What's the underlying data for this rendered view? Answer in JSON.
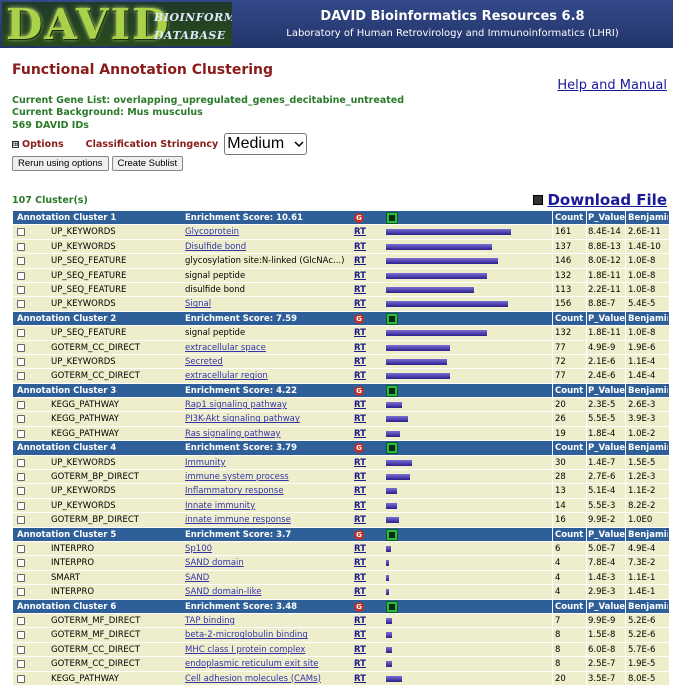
{
  "header": {
    "logo_text": "DAVID",
    "logo_sub1": "BIOINFORMATICS",
    "logo_sub2": "DATABASE",
    "title": "DAVID Bioinformatics Resources 6.8",
    "subtitle": "Laboratory of Human Retrovirology and Immunoinformatics (LHRI)"
  },
  "page_title": "Functional Annotation Clustering",
  "help_link": "Help and Manual",
  "gene_info": {
    "current_list": "Current Gene List: overlapping_upregulated_genes_decitabine_untreated",
    "background": "Current Background: Mus musculus",
    "ids": "569 DAVID IDs"
  },
  "options": {
    "plus": "⊞",
    "options_label": "Options",
    "stringency_label": "Classification Stringency",
    "stringency_value": "Medium",
    "rerun_button": "Rerun using options",
    "sublist_button": "Create Sublist"
  },
  "cluster_count": "107 Cluster(s)",
  "download_label": "Download File",
  "table_headers": {
    "count": "Count",
    "p_value": "P_Value",
    "benjamini": "Benjamini"
  },
  "clusters": [
    {
      "name": "Annotation Cluster 1",
      "score": "Enrichment Score: 10.61",
      "rows": [
        {
          "cat": "UP_KEYWORDS",
          "term": "Glycoprotein",
          "link": true,
          "bar": 0.78,
          "count": "161",
          "p": "8.4E-14",
          "b": "2.6E-11"
        },
        {
          "cat": "UP_KEYWORDS",
          "term": "Disulfide bond",
          "link": true,
          "bar": 0.66,
          "count": "137",
          "p": "8.8E-13",
          "b": "1.4E-10"
        },
        {
          "cat": "UP_SEQ_FEATURE",
          "term": "glycosylation site:N-linked (GlcNAc...)",
          "link": false,
          "bar": 0.7,
          "count": "146",
          "p": "8.0E-12",
          "b": "1.0E-8"
        },
        {
          "cat": "UP_SEQ_FEATURE",
          "term": "signal peptide",
          "link": false,
          "bar": 0.63,
          "count": "132",
          "p": "1.8E-11",
          "b": "1.0E-8"
        },
        {
          "cat": "UP_SEQ_FEATURE",
          "term": "disulfide bond",
          "link": false,
          "bar": 0.55,
          "count": "113",
          "p": "2.2E-11",
          "b": "1.0E-8"
        },
        {
          "cat": "UP_KEYWORDS",
          "term": "Signal",
          "link": true,
          "bar": 0.76,
          "count": "156",
          "p": "8.8E-7",
          "b": "5.4E-5"
        }
      ]
    },
    {
      "name": "Annotation Cluster 2",
      "score": "Enrichment Score: 7.59",
      "rows": [
        {
          "cat": "UP_SEQ_FEATURE",
          "term": "signal peptide",
          "link": false,
          "bar": 0.63,
          "count": "132",
          "p": "1.8E-11",
          "b": "1.0E-8"
        },
        {
          "cat": "GOTERM_CC_DIRECT",
          "term": "extracellular space",
          "link": true,
          "bar": 0.4,
          "count": "77",
          "p": "4.9E-9",
          "b": "1.9E-6"
        },
        {
          "cat": "UP_KEYWORDS",
          "term": "Secreted",
          "link": true,
          "bar": 0.38,
          "count": "72",
          "p": "2.1E-6",
          "b": "1.1E-4"
        },
        {
          "cat": "GOTERM_CC_DIRECT",
          "term": "extracellular region",
          "link": true,
          "bar": 0.4,
          "count": "77",
          "p": "2.4E-6",
          "b": "1.4E-4"
        }
      ]
    },
    {
      "name": "Annotation Cluster 3",
      "score": "Enrichment Score: 4.22",
      "rows": [
        {
          "cat": "KEGG_PATHWAY",
          "term": "Rap1 signaling pathway",
          "link": true,
          "bar": 0.1,
          "count": "20",
          "p": "2.3E-5",
          "b": "2.6E-3"
        },
        {
          "cat": "KEGG_PATHWAY",
          "term": "PI3K-Akt signaling pathway",
          "link": true,
          "bar": 0.14,
          "count": "26",
          "p": "5.5E-5",
          "b": "3.9E-3"
        },
        {
          "cat": "KEGG_PATHWAY",
          "term": "Ras signaling pathway",
          "link": true,
          "bar": 0.09,
          "count": "19",
          "p": "1.8E-4",
          "b": "1.0E-2"
        }
      ]
    },
    {
      "name": "Annotation Cluster 4",
      "score": "Enrichment Score: 3.79",
      "rows": [
        {
          "cat": "UP_KEYWORDS",
          "term": "Immunity",
          "link": true,
          "bar": 0.16,
          "count": "30",
          "p": "1.4E-7",
          "b": "1.5E-5"
        },
        {
          "cat": "GOTERM_BP_DIRECT",
          "term": "immune system process",
          "link": true,
          "bar": 0.15,
          "count": "28",
          "p": "2.7E-6",
          "b": "1.2E-3"
        },
        {
          "cat": "UP_KEYWORDS",
          "term": "Inflammatory response",
          "link": true,
          "bar": 0.07,
          "count": "13",
          "p": "5.1E-4",
          "b": "1.1E-2"
        },
        {
          "cat": "UP_KEYWORDS",
          "term": "Innate immunity",
          "link": true,
          "bar": 0.07,
          "count": "14",
          "p": "5.5E-3",
          "b": "8.2E-2"
        },
        {
          "cat": "GOTERM_BP_DIRECT",
          "term": "innate immune response",
          "link": true,
          "bar": 0.08,
          "count": "16",
          "p": "9.9E-2",
          "b": "1.0E0"
        }
      ]
    },
    {
      "name": "Annotation Cluster 5",
      "score": "Enrichment Score: 3.7",
      "rows": [
        {
          "cat": "INTERPRO",
          "term": "Sp100",
          "link": true,
          "bar": 0.03,
          "count": "6",
          "p": "5.0E-7",
          "b": "4.9E-4"
        },
        {
          "cat": "INTERPRO",
          "term": "SAND domain",
          "link": true,
          "bar": 0.02,
          "count": "4",
          "p": "7.8E-4",
          "b": "7.3E-2"
        },
        {
          "cat": "SMART",
          "term": "SAND",
          "link": true,
          "bar": 0.02,
          "count": "4",
          "p": "1.4E-3",
          "b": "1.1E-1"
        },
        {
          "cat": "INTERPRO",
          "term": "SAND domain-like",
          "link": true,
          "bar": 0.02,
          "count": "4",
          "p": "2.9E-3",
          "b": "1.4E-1"
        }
      ]
    },
    {
      "name": "Annotation Cluster 6",
      "score": "Enrichment Score: 3.48",
      "rows": [
        {
          "cat": "GOTERM_MF_DIRECT",
          "term": "TAP binding",
          "link": true,
          "bar": 0.035,
          "count": "7",
          "p": "9.9E-9",
          "b": "5.2E-6"
        },
        {
          "cat": "GOTERM_MF_DIRECT",
          "term": "beta-2-microglobulin binding",
          "link": true,
          "bar": 0.04,
          "count": "8",
          "p": "1.5E-8",
          "b": "5.2E-6"
        },
        {
          "cat": "GOTERM_CC_DIRECT",
          "term": "MHC class I protein complex",
          "link": true,
          "bar": 0.04,
          "count": "8",
          "p": "6.0E-8",
          "b": "5.7E-6"
        },
        {
          "cat": "GOTERM_CC_DIRECT",
          "term": "endoplasmic reticulum exit site",
          "link": true,
          "bar": 0.04,
          "count": "8",
          "p": "2.5E-7",
          "b": "1.9E-5"
        },
        {
          "cat": "KEGG_PATHWAY",
          "term": "Cell adhesion molecules (CAMs)",
          "link": true,
          "bar": 0.1,
          "count": "20",
          "p": "3.5E-7",
          "b": "8.0E-5"
        }
      ]
    }
  ],
  "rt_label": "RT",
  "g_icon_text": "G",
  "icons": {
    "options_toggle": "plus-box-icon",
    "download": "floppy-disk-icon",
    "g": "go-graph-icon",
    "tree": "gene-tree-icon"
  }
}
